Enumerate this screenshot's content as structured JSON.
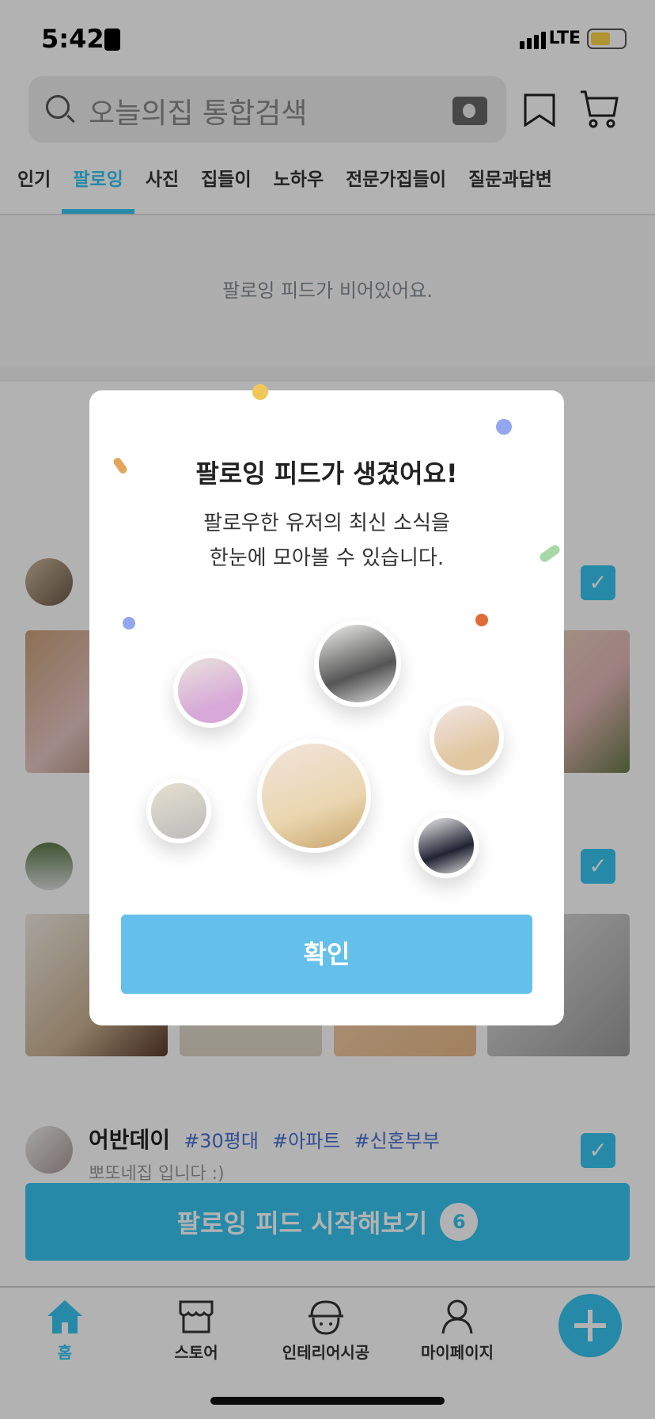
{
  "status_bar": {
    "time": "5:42",
    "network": "LTE",
    "battery_color": "#fcd34a"
  },
  "search": {
    "placeholder": "오늘의집 통합검색"
  },
  "tabs": [
    {
      "label": "인기"
    },
    {
      "label": "팔로잉",
      "active": true
    },
    {
      "label": "사진"
    },
    {
      "label": "집들이"
    },
    {
      "label": "노하우"
    },
    {
      "label": "전문가집들이"
    },
    {
      "label": "질문과답변"
    }
  ],
  "feed": {
    "empty_text": "팔로잉 피드가 비어있어요."
  },
  "recommended": [
    {
      "name": "어반데이",
      "tags": [
        "#30평대",
        "#아파트",
        "#신혼부부"
      ],
      "desc": "뽀또네집 입니다 :)",
      "checked": true
    }
  ],
  "start_button": {
    "label": "팔로잉 피드 시작해보기",
    "count": "6"
  },
  "bottom_nav": [
    {
      "label": "홈",
      "icon": "home-icon",
      "active": true
    },
    {
      "label": "스토어",
      "icon": "store-icon"
    },
    {
      "label": "인테리어시공",
      "icon": "helmet-icon"
    },
    {
      "label": "마이페이지",
      "icon": "person-icon"
    }
  ],
  "modal": {
    "title": "팔로잉 피드가 생겼어요!",
    "body_line1": "팔로우한 유저의 최신 소식을",
    "body_line2": "한눈에 모아볼 수 있습니다.",
    "confirm_label": "확인"
  },
  "colors": {
    "accent": "#35c5f0",
    "modal_button": "#64c0ea",
    "hashtag": "#4a6fd0"
  }
}
